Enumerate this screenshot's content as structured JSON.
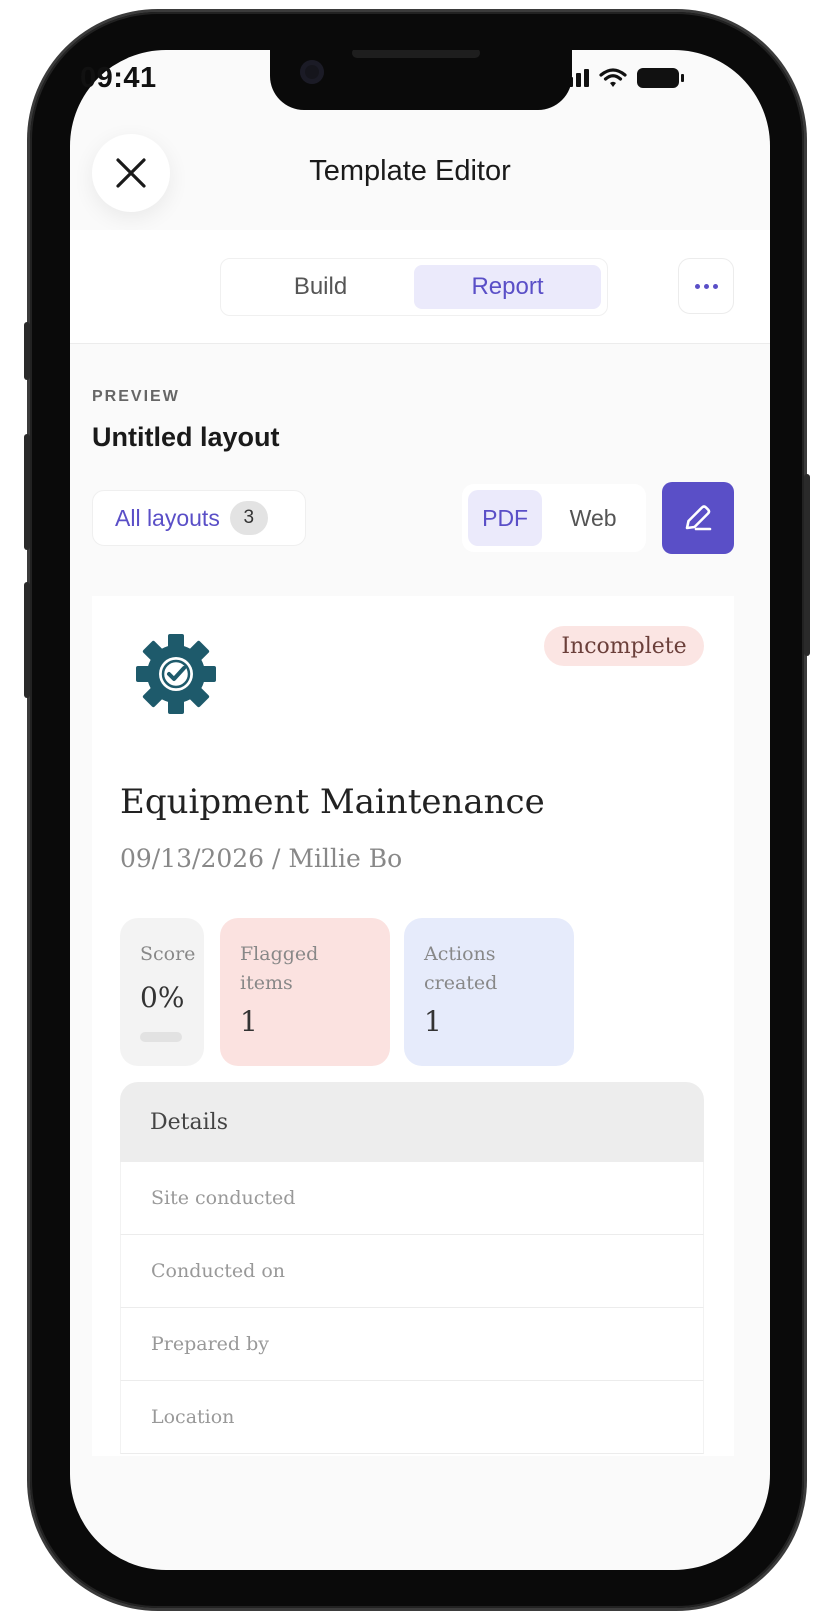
{
  "status_bar": {
    "time": "09:41"
  },
  "header": {
    "title": "Template Editor"
  },
  "tabs": [
    {
      "label": "Build",
      "active": false
    },
    {
      "label": "Report",
      "active": true
    }
  ],
  "preview": {
    "label": "PREVIEW",
    "layout_name": "Untitled layout",
    "all_layouts_label": "All layouts",
    "layouts_count": "3",
    "formats": [
      {
        "label": "PDF",
        "active": true
      },
      {
        "label": "Web",
        "active": false
      }
    ]
  },
  "report": {
    "status": "Incomplete",
    "title": "Equipment Maintenance",
    "subtitle": "09/13/2026 / Millie Bo",
    "stats": {
      "score": {
        "label": "Score",
        "value": "0%"
      },
      "flagged": {
        "label": "Flagged items",
        "value": "1"
      },
      "actions": {
        "label": "Actions created",
        "value": "1"
      }
    },
    "details": {
      "heading": "Details",
      "rows": [
        "Site conducted",
        "Conducted on",
        "Prepared by",
        "Location"
      ]
    }
  },
  "colors": {
    "accent": "#5a4fc7",
    "accent_light": "#ebeafb",
    "status_incomplete_bg": "#fbe5e3",
    "flagged_bg": "#fbe2e0",
    "actions_bg": "#e6ebfb",
    "logo": "#1e5a6b"
  },
  "icons": [
    "close-icon",
    "more-icon",
    "pencil-icon",
    "gear-check-icon",
    "signal-icon",
    "wifi-icon",
    "battery-icon"
  ]
}
